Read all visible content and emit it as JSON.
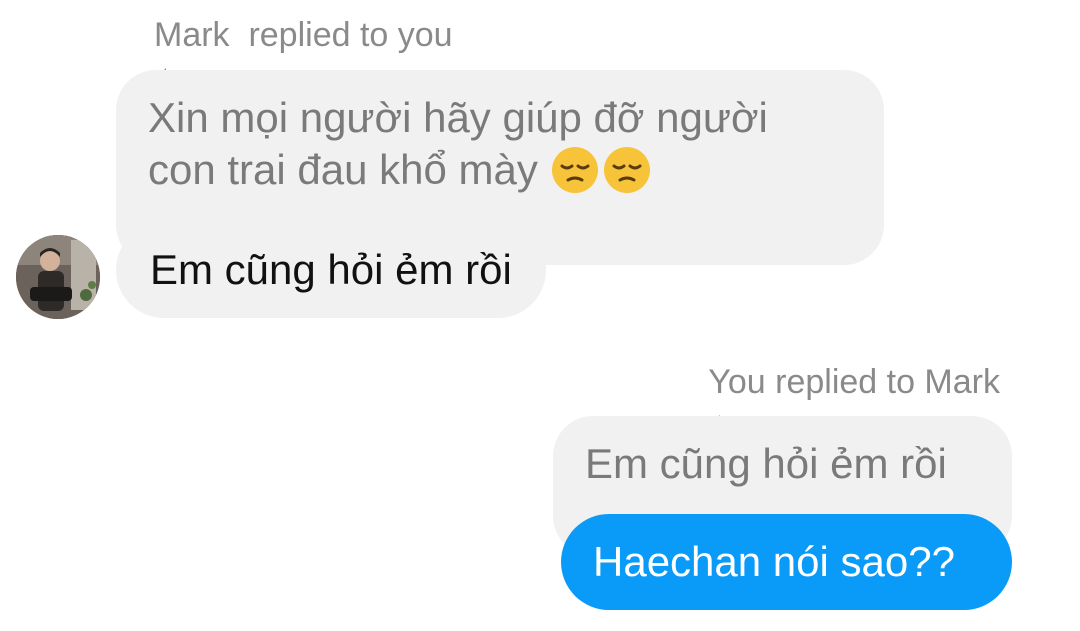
{
  "thread": {
    "incoming": {
      "reply_label": "Mark  replied to you",
      "quoted_text_line1": "Xin mọi người hãy giúp đỡ người",
      "quoted_text_line2": "con trai đau khổ mày",
      "quoted_emoji": "😔😔",
      "message_text": "Em cũng hỏi ẻm rồi",
      "avatar_icon": "avatar-photo"
    },
    "outgoing": {
      "reply_label": "You replied to Mark",
      "quoted_text": "Em cũng hỏi ẻm rồi",
      "message_text": "Haechan nói sao??"
    }
  },
  "colors": {
    "quoted_bg": "#f1f1f1",
    "outgoing_bubble": "#0a9af7",
    "label_gray": "#8a8a8a"
  }
}
